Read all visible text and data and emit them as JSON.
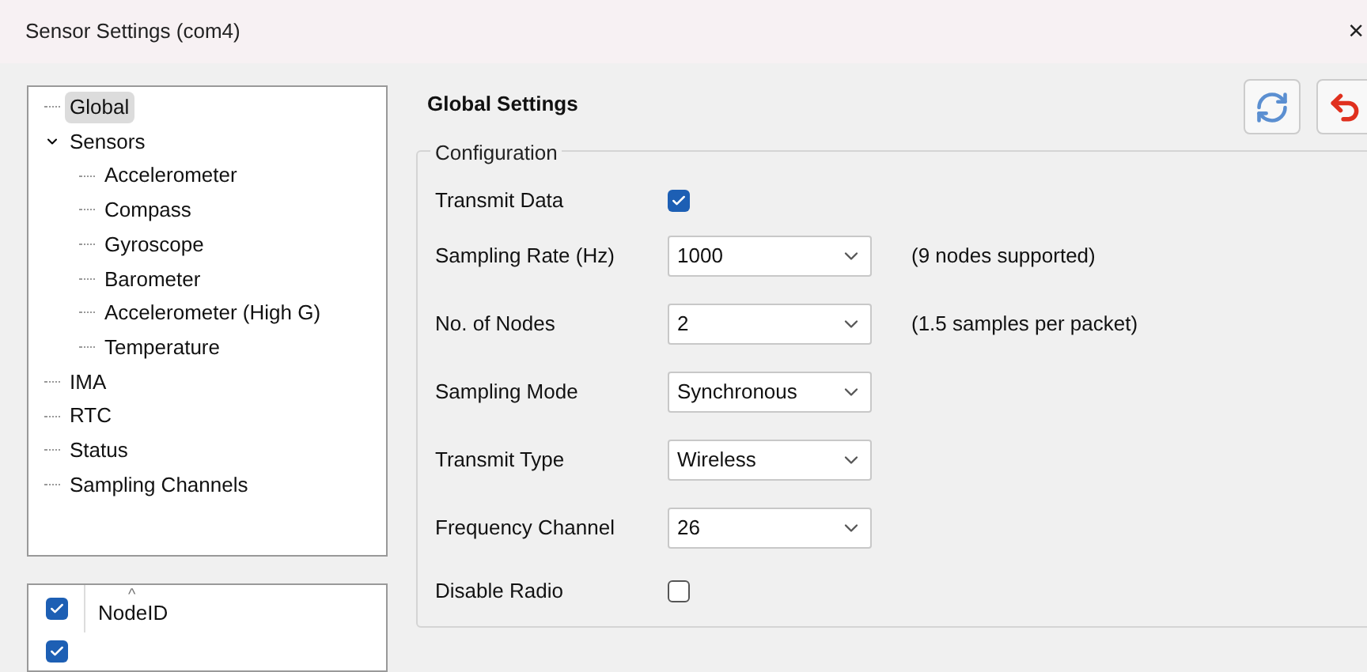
{
  "window": {
    "title": "Sensor Settings (com4)",
    "close": "×"
  },
  "tree": [
    {
      "label": "Global",
      "selected": true
    },
    {
      "label": "Sensors",
      "selected": false,
      "expanded": true,
      "children": [
        {
          "label": "Accelerometer",
          "selected": false
        },
        {
          "label": "Compass",
          "selected": false
        },
        {
          "label": "Gyroscope",
          "selected": false
        },
        {
          "label": "Barometer",
          "selected": false
        },
        {
          "label": "Accelerometer (High G)",
          "selected": false
        },
        {
          "label": "Temperature",
          "selected": false
        }
      ]
    },
    {
      "label": "IMA",
      "selected": false
    },
    {
      "label": "RTC",
      "selected": false
    },
    {
      "label": "Status",
      "selected": false
    },
    {
      "label": "Sampling Channels",
      "selected": false
    }
  ],
  "channel_list": {
    "sort_marker": "^",
    "rows": [
      {
        "label": "NodeID",
        "checked": true
      },
      {
        "checked": true
      }
    ]
  },
  "panel": {
    "title": "Global Settings",
    "group": "Configuration",
    "fields": [
      {
        "kind": "checkbox",
        "label": "Transmit Data",
        "checked": true
      },
      {
        "kind": "select",
        "label": "Sampling Rate (Hz)",
        "value": "1000",
        "note": "(9 nodes supported)"
      },
      {
        "kind": "select",
        "label": "No. of Nodes",
        "value": "2",
        "note": "(1.5 samples per packet)"
      },
      {
        "kind": "select",
        "label": "Sampling Mode",
        "value": "Synchronous"
      },
      {
        "kind": "select",
        "label": "Transmit Type",
        "value": "Wireless"
      },
      {
        "kind": "select",
        "label": "Frequency Channel",
        "value": "26"
      },
      {
        "kind": "checkbox",
        "label": "Disable Radio",
        "checked": false
      }
    ]
  }
}
